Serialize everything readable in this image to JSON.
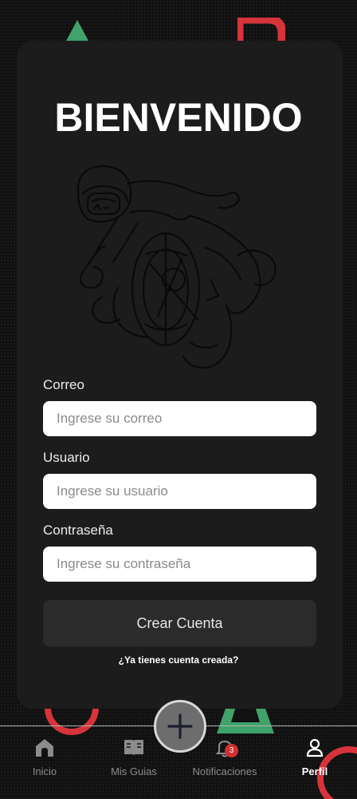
{
  "title": "BIENVENIDO",
  "form": {
    "email_label": "Correo",
    "email_placeholder": "Ingrese su correo",
    "username_label": "Usuario",
    "username_placeholder": "Ingrese su usuario",
    "password_label": "Contraseña",
    "password_placeholder": "Ingrese su contraseña",
    "submit_label": "Crear Cuenta",
    "login_link": "¿Ya tienes cuenta creada?"
  },
  "nav": {
    "items": [
      {
        "label": "Inicio",
        "icon": "home-icon"
      },
      {
        "label": "Mis Guias",
        "icon": "book-icon"
      },
      {
        "label": "Notificaciones",
        "icon": "bell-icon",
        "badge": "3"
      },
      {
        "label": "Perfil",
        "icon": "user-icon",
        "active": true
      }
    ],
    "fab_icon": "plus-icon"
  },
  "colors": {
    "background": "#111111",
    "card": "#1c1c1c",
    "deco_green": "#3fa36b",
    "deco_red": "#d6343a",
    "badge": "#d32f2f"
  }
}
